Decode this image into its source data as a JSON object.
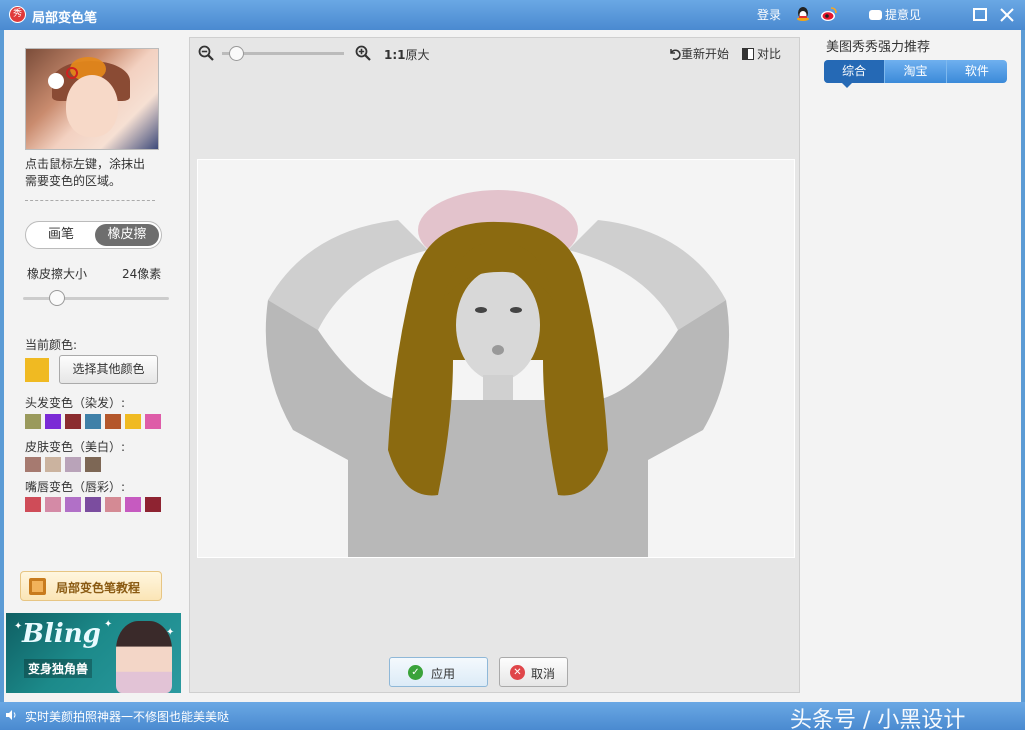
{
  "window": {
    "title": "局部变色笔",
    "login": "登录",
    "feedback": "提意见",
    "logo_text": "秀"
  },
  "left_panel": {
    "hint_line1": "点击鼠标左键，涂抹出",
    "hint_line2": "需要变色的区域。",
    "mode_brush": "画笔",
    "mode_eraser": "橡皮擦",
    "active_mode": "橡皮擦",
    "size_label": "橡皮擦大小",
    "size_value": "24像素",
    "current_color_label": "当前颜色:",
    "current_color": "#f0ba22",
    "pick_color_button": "选择其他颜色",
    "hair_label": "头发变色（染发）:",
    "hair_colors": [
      "#9a9a5c",
      "#7b2bd6",
      "#8b2c2f",
      "#3f80a8",
      "#b4572b",
      "#f0ba22",
      "#de5ca8"
    ],
    "skin_label": "皮肤变色（美白）:",
    "skin_colors": [
      "#a67a70",
      "#cbb39f",
      "#b9a3b9",
      "#7d6755"
    ],
    "lip_label": "嘴唇变色（唇彩）:",
    "lip_colors": [
      "#cf4c58",
      "#d48aa6",
      "#b170c7",
      "#7b4d9f",
      "#d48a94",
      "#c65ac0",
      "#8e2331"
    ],
    "tutorial_button": "局部变色笔教程",
    "banner_title": "Bling",
    "banner_subtitle": "变身独角兽"
  },
  "canvas": {
    "original_size_ratio": "1:1",
    "original_size_label": "原大",
    "restart": "重新开始",
    "compare": "对比",
    "apply_button": "应用",
    "cancel_button": "取消",
    "hair_tint": "#8b6a10"
  },
  "right_panel": {
    "title": "美图秀秀强力推荐",
    "tabs": [
      "综合",
      "淘宝",
      "软件"
    ],
    "active_tab": "综合"
  },
  "statusbar": {
    "text": "实时美颜拍照神器一不修图也能美美哒",
    "watermark": "头条号 / 小黑设计"
  }
}
